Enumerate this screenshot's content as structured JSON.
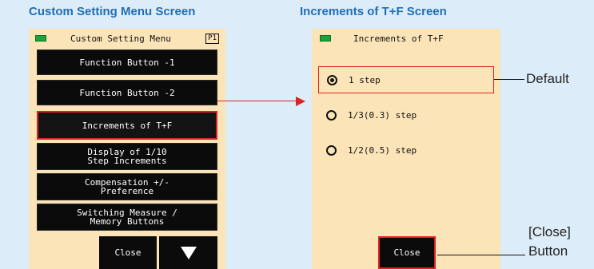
{
  "left_heading": "Custom Setting Menu Screen",
  "right_heading": "Increments of T+F Screen",
  "left_screen": {
    "title": "Custom Setting Menu",
    "page": "P1",
    "items": [
      {
        "label": "Function Button -1"
      },
      {
        "label": "Function Button -2"
      },
      {
        "label": "Increments of T+F"
      },
      {
        "label": "Display of 1/10\nStep Increments"
      },
      {
        "label": "Compensation +/-\nPreference"
      },
      {
        "label": "Switching Measure /\nMemory Buttons"
      }
    ],
    "close_label": "Close",
    "down_icon": "triangle-down"
  },
  "right_screen": {
    "title": "Increments of T+F",
    "options": [
      {
        "label": "1 step",
        "selected": true
      },
      {
        "label": "1/3(0.3) step",
        "selected": false
      },
      {
        "label": "1/2(0.5) step",
        "selected": false
      }
    ],
    "close_label": "Close"
  },
  "callouts": {
    "default_label": "Default",
    "close_label_line1": "[Close]",
    "close_label_line2": "Button"
  },
  "colors": {
    "heading": "#1f6fb5",
    "highlight": "#e02020",
    "screen_bg": "#fbe4b8",
    "battery": "#1aa53a"
  }
}
